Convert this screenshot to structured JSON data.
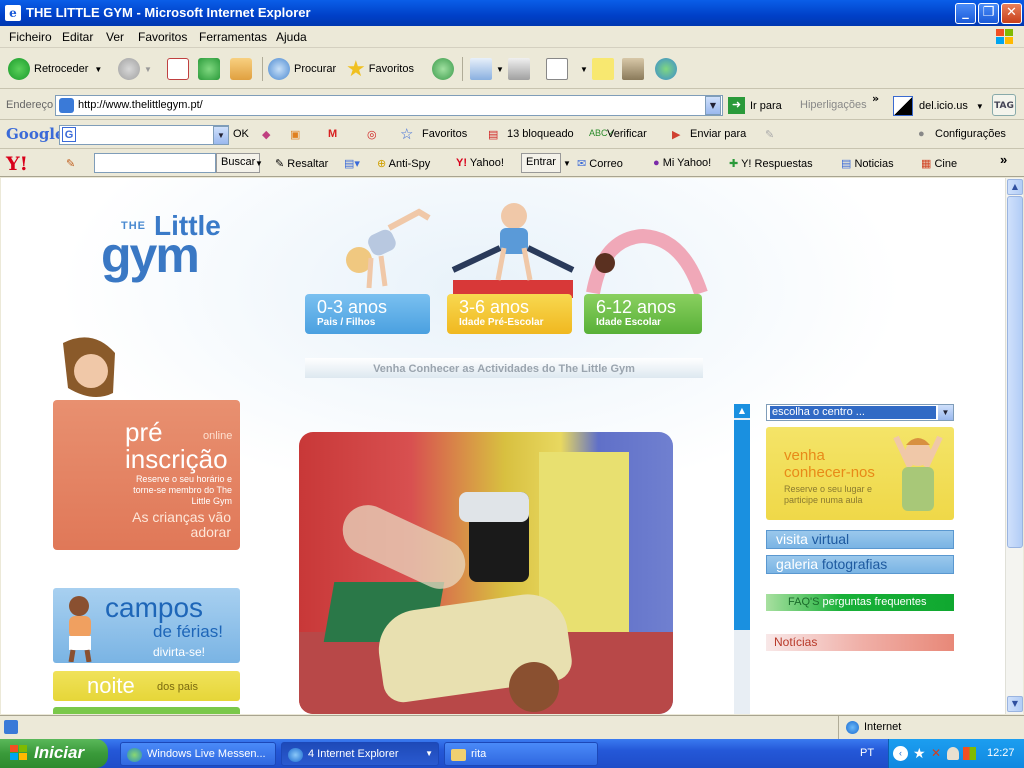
{
  "window": {
    "title": "THE LITTLE GYM - Microsoft Internet Explorer",
    "minimize_glyph": "_",
    "maximize_glyph": "❐",
    "close_glyph": "✕"
  },
  "menubar": {
    "items": [
      "Ficheiro",
      "Editar",
      "Ver",
      "Favoritos",
      "Ferramentas",
      "Ajuda"
    ]
  },
  "toolbar": {
    "back_label": "Retroceder",
    "search_label": "Procurar",
    "favorites_label": "Favoritos"
  },
  "address": {
    "label": "Endereço",
    "url": "http://www.thelittlegym.pt/",
    "go_label": "Ir para",
    "links_label": "Hiperligações",
    "delicious_label": "del.icio.us",
    "tag_label": "TAG"
  },
  "google_bar": {
    "logo": "Google",
    "ok_label": "OK",
    "favoritos_label": "Favoritos",
    "blocked_label": "13 bloqueado",
    "verify_label": "Verificar",
    "send_label": "Enviar para",
    "settings_label": "Configurações"
  },
  "yahoo_bar": {
    "logo": "Y!",
    "search_label": "Buscar",
    "highlight_label": "Resaltar",
    "antispy_label": "Anti-Spy",
    "yahoo_label": "Yahoo!",
    "enter_label": "Entrar",
    "mail_label": "Correo",
    "myyahoo_label": "Mi Yahoo!",
    "answers_label": "Y! Respuestas",
    "news_label": "Noticias",
    "cine_label": "Cine"
  },
  "site": {
    "logo_the": "THE",
    "logo_little": "Little",
    "logo_gym": "gym",
    "age_groups": [
      {
        "range": "0-3 anos",
        "sub": "Pais / Filhos",
        "color": "#5aaee8"
      },
      {
        "range": "3-6 anos",
        "sub": "Idade Pré-Escolar",
        "color": "#f4c82a"
      },
      {
        "range": "6-12 anos",
        "sub": "Idade Escolar",
        "color": "#6ac04a"
      }
    ],
    "venha_strip": "Venha Conhecer as Actividades do The Little Gym",
    "pre_inscricao": {
      "title1": "pré",
      "online": "online",
      "title2": "inscrição",
      "desc": "Reserve o seu horário e torne-se membro do The Little Gym",
      "tagline": "As crianças vão adorar"
    },
    "campos": {
      "title": "campos",
      "sub": "de férias!",
      "tag": "divirta-se!"
    },
    "noite": {
      "title": "noite",
      "sub": "dos pais"
    },
    "centro_select": "escolha o centro ...",
    "conhecer": {
      "title": "venha conhecer-nos",
      "desc": "Reserve o seu lugar e participe numa aula"
    },
    "visita": {
      "light": "visita",
      "bold": "virtual"
    },
    "galeria": {
      "light": "galeria",
      "bold": "fotografias"
    },
    "faq": {
      "light": "FAQ'S",
      "bold": "perguntas frequentes"
    },
    "noticias": "Notícias"
  },
  "statusbar": {
    "zone": "Internet"
  },
  "taskbar": {
    "start": "Iniciar",
    "tasks": [
      {
        "label": "Windows Live Messen..."
      },
      {
        "label": "4 Internet Explorer"
      },
      {
        "label": "rita"
      }
    ],
    "lang": "PT",
    "clock": "12:27"
  },
  "colors": {
    "xp_blue": "#0a5ee8",
    "brand_blue": "#3a78c4",
    "pre_orange": "#e07858",
    "conhecer_yellow": "#efd848"
  }
}
